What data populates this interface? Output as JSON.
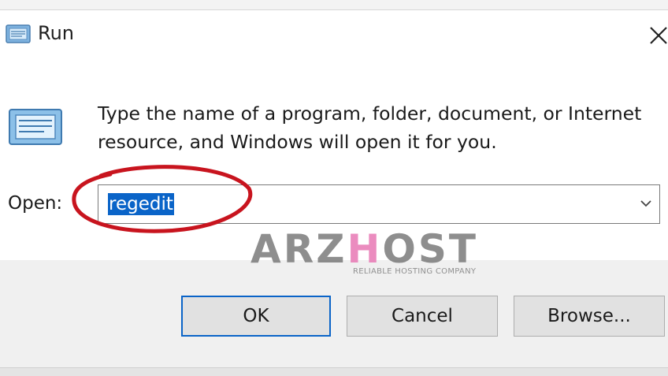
{
  "window": {
    "title": "Run",
    "icon": "run-icon",
    "close_icon": "close-icon"
  },
  "content": {
    "description_line1": "Type the name of a program, folder, document, or Internet",
    "description_line2": "resource, and Windows will open it for you.",
    "open_label": "Open:",
    "open_value": "regedit",
    "dropdown_icon": "chevron-down-icon"
  },
  "buttons": {
    "ok": "OK",
    "cancel": "Cancel",
    "browse": "Browse..."
  },
  "watermark": {
    "logo_part1": "ARZ",
    "logo_part2": "H",
    "logo_part3": "OST",
    "tagline": "RELIABLE HOSTING COMPANY"
  },
  "colors": {
    "accent": "#0a64c8",
    "highlight_circle": "#c8141e",
    "footer_bg": "#f0f0f0"
  }
}
